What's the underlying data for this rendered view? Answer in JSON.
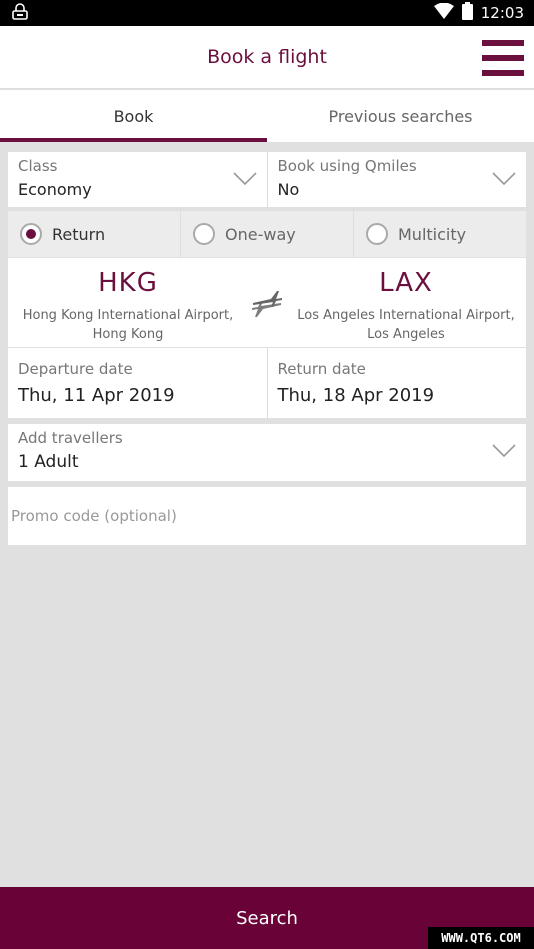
{
  "status_bar": {
    "time": "12:03"
  },
  "app_bar": {
    "title": "Book a flight"
  },
  "tabs": [
    {
      "label": "Book",
      "active": true
    },
    {
      "label": "Previous searches",
      "active": false
    }
  ],
  "class_field": {
    "label": "Class",
    "value": "Economy"
  },
  "qmiles_field": {
    "label": "Book using Qmiles",
    "value": "No"
  },
  "trip_types": [
    {
      "label": "Return",
      "selected": true
    },
    {
      "label": "One-way",
      "selected": false
    },
    {
      "label": "Multicity",
      "selected": false
    }
  ],
  "origin": {
    "code": "HKG",
    "airport": "Hong Kong International Airport,",
    "city": "Hong Kong"
  },
  "destination": {
    "code": "LAX",
    "airport": "Los Angeles International Airport,",
    "city": "Los Angeles"
  },
  "departure": {
    "label": "Departure date",
    "value": "Thu, 11 Apr 2019"
  },
  "return_date": {
    "label": "Return date",
    "value": "Thu, 18 Apr 2019"
  },
  "travellers": {
    "label": "Add travellers",
    "value": "1 Adult"
  },
  "promo": {
    "placeholder": "Promo code (optional)",
    "value": ""
  },
  "search_button": {
    "label": "Search"
  },
  "watermark": "WWW.QT6.COM",
  "colors": {
    "brand": "#6b0f3e",
    "button": "#690337",
    "background": "#e0e0e0"
  }
}
